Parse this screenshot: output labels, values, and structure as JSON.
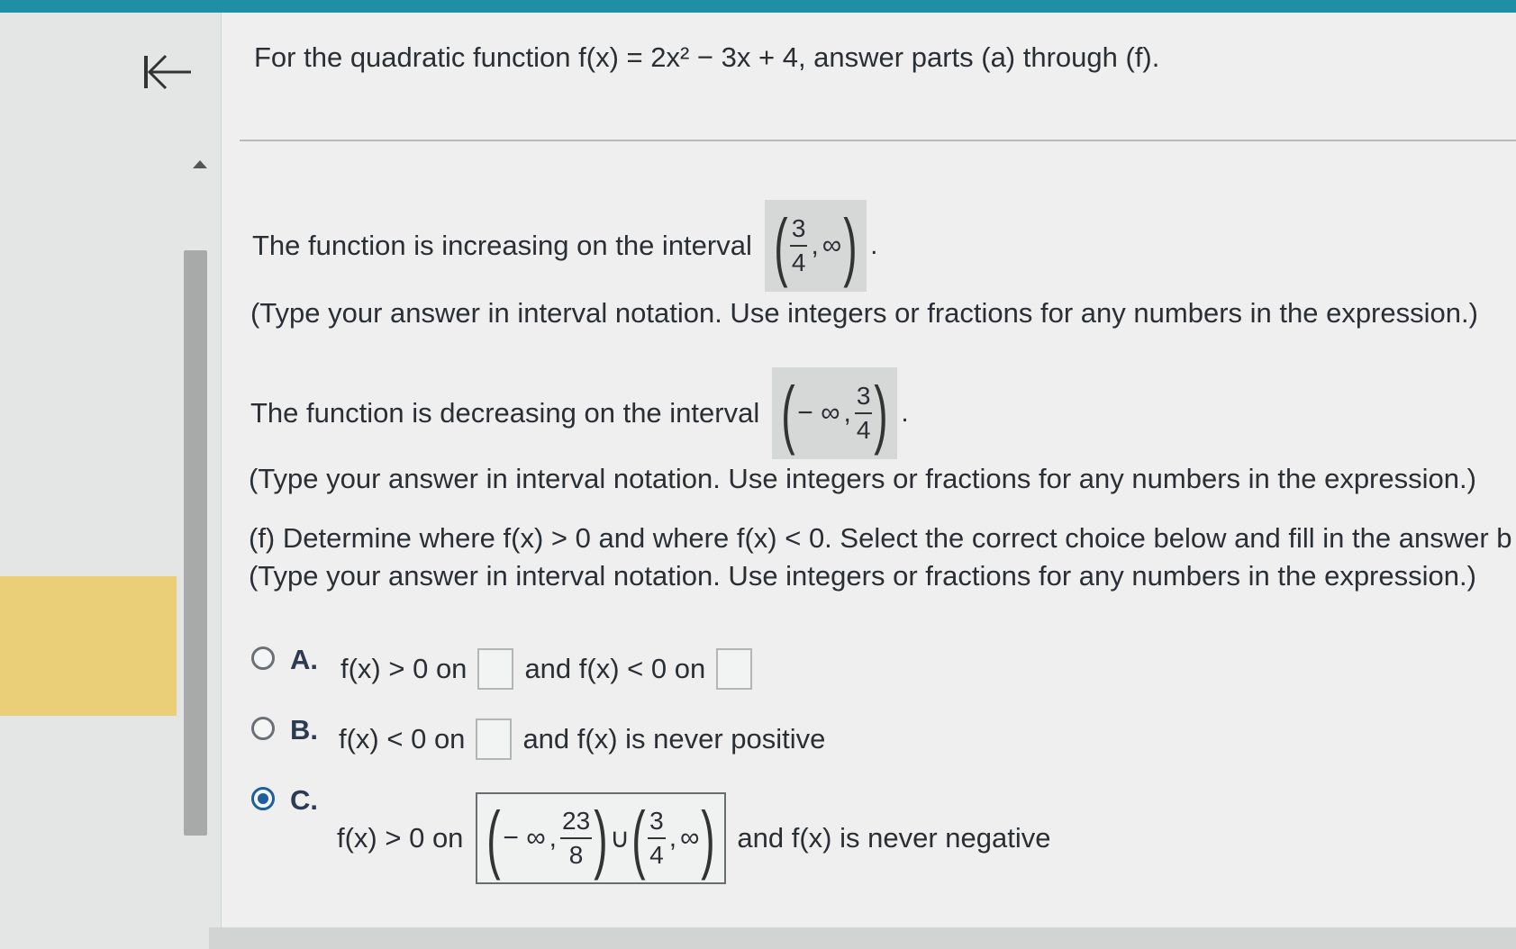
{
  "header": {
    "question": "For the quadratic function f(x) = 2x² − 3x + 4, answer parts (a) through (f)."
  },
  "increasing": {
    "prefix": "The function is increasing on the interval",
    "answer": {
      "open": "(",
      "num": "3",
      "den": "4",
      "sep": ",",
      "end": "∞",
      "close": ")"
    },
    "hint": "(Type your answer in interval notation. Use integers or fractions for any numbers in the expression.)"
  },
  "decreasing": {
    "prefix": "The function is decreasing on the interval",
    "answer": {
      "open": "(",
      "start": "− ∞",
      "sep": ",",
      "num": "3",
      "den": "4",
      "close": ")"
    },
    "hint": "(Type your answer in interval notation. Use integers or fractions for any numbers in the expression.)"
  },
  "part_f": {
    "line1": "(f) Determine where f(x) > 0 and where f(x) < 0. Select the correct choice below and fill in the answer b",
    "line2": "(Type your answer in interval notation. Use integers or fractions for any numbers in the expression.)"
  },
  "options": [
    {
      "letter": "A.",
      "text1": "f(x) > 0 on",
      "text2": "and f(x) < 0 on",
      "selected": false
    },
    {
      "letter": "B.",
      "text1": "f(x) < 0 on",
      "text2": "and f(x) is never positive",
      "selected": false
    },
    {
      "letter": "C.",
      "text1": "f(x) > 0 on",
      "text2": "and f(x) is never negative",
      "selected": true,
      "answer": {
        "start": "− ∞",
        "sep": ",",
        "num1": "23",
        "den1": "8",
        "union": "∪",
        "num2": "3",
        "den2": "4",
        "end": "∞"
      }
    }
  ],
  "colors": {
    "accent": "#1f8fa6",
    "selected": "#1f5d9e",
    "highlight": "#ebcf78"
  }
}
